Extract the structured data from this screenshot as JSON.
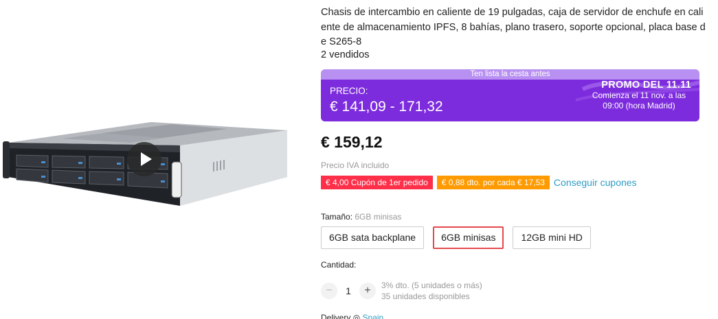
{
  "gallery": {
    "image_alt": "2U rack server chassis with 8 hot-swap drive bays",
    "play_icon": "play-icon"
  },
  "product": {
    "title": "Chasis de intercambio en caliente de 19 pulgadas, caja de servidor de enchufe en caliente de almacenamiento IPFS, 8 bahías, plano trasero, soporte opcional, placa base de S265-8",
    "sold": "2 vendidos"
  },
  "promo": {
    "banner_top": "Ten lista la cesta antes",
    "price_label": "PRECIO:",
    "price_range": "€ 141,09 - 171,32",
    "event_name": "PROMO DEL",
    "event_date": "11.11",
    "starts": "Comienza el 11 nov. a las 09:00 (hora Madrid)",
    "colors": {
      "top": "#b890f1",
      "body": "#7d2cdd"
    }
  },
  "price": {
    "current": "€ 159,12",
    "tax_note": "Precio IVA incluido"
  },
  "coupons": {
    "first_order": "€ 4,00 Cupón de 1er pedido",
    "per_spend": "€ 0,88 dto. por cada € 17,53",
    "get_link": "Conseguir cupones",
    "colors": {
      "red": "#fe2f49",
      "orange": "#ff9a00",
      "link": "#2e9cc3"
    }
  },
  "size": {
    "label": "Tamaño:",
    "selected": "6GB minisas",
    "options": [
      "6GB sata backplane",
      "6GB minisas",
      "12GB mini HD"
    ]
  },
  "quantity": {
    "label": "Cantidad:",
    "value": "1",
    "minus": "−",
    "plus": "+",
    "discount": "3% dto. (5 unidades o más)",
    "available": "35 unidades disponibles"
  },
  "delivery": {
    "label": "Delivery",
    "location": "Spain"
  }
}
